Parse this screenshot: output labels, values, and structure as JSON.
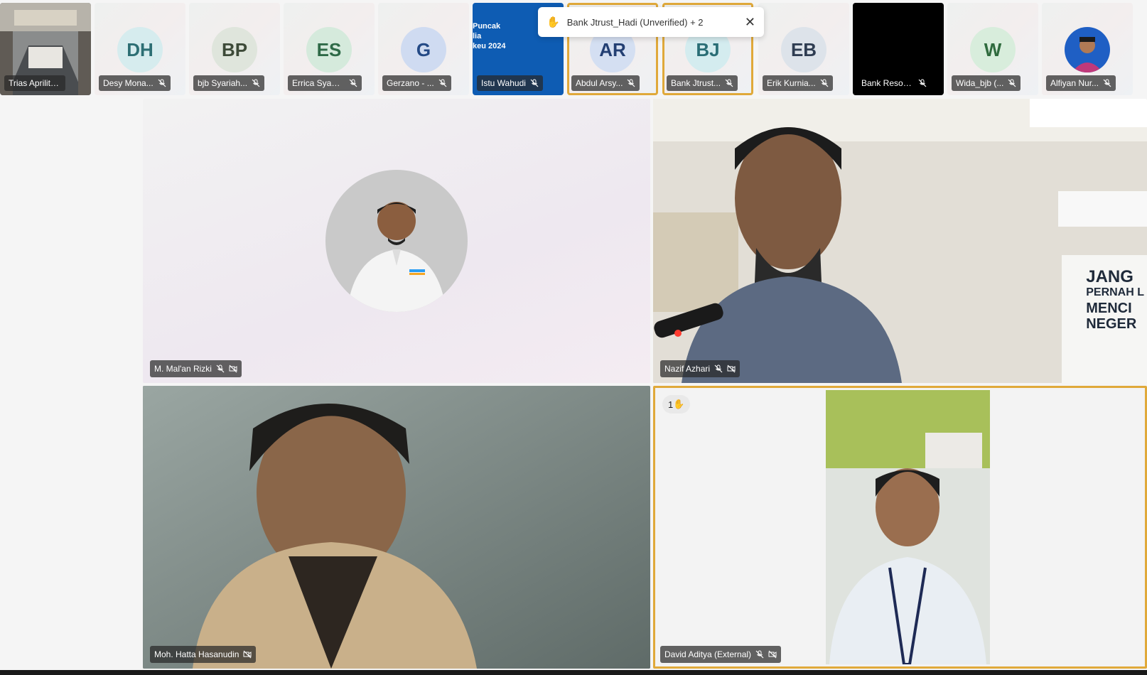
{
  "raise_hand_toast": {
    "text": "Bank Jtrust_Hadi (Unverified) + 2",
    "icon": "raised-hand-icon",
    "close_icon": "close-icon"
  },
  "thumbnails": [
    {
      "name": "Trias Aprilitania",
      "initials": "",
      "type": "video-room"
    },
    {
      "name": "Desy Mona...",
      "initials": "DH",
      "avatar_bg": "#d6ecee",
      "avatar_fg": "#2d6f74"
    },
    {
      "name": "bjb Syariah...",
      "initials": "BP",
      "avatar_bg": "#dfe5dc",
      "avatar_fg": "#3d4a38"
    },
    {
      "name": "Errica Syam...",
      "initials": "ES",
      "avatar_bg": "#d5eadc",
      "avatar_fg": "#2e6a47"
    },
    {
      "name": "Gerzano - ...",
      "initials": "G",
      "avatar_bg": "#cfdbf1",
      "avatar_fg": "#244a86"
    },
    {
      "name": "Istu Wahudi",
      "initials": "",
      "type": "slide",
      "slide_lines": [
        "Puncak",
        "lia",
        "keu 2024"
      ]
    },
    {
      "name": "Abdul Arsy...",
      "initials": "AR",
      "avatar_bg": "#d4dff2",
      "avatar_fg": "#233f73",
      "raised": true
    },
    {
      "name": "Bank Jtrust...",
      "initials": "BJ",
      "avatar_bg": "#d4ecef",
      "avatar_fg": "#2b6e76",
      "raised": true
    },
    {
      "name": "Erik Kurnia...",
      "initials": "EB",
      "avatar_bg": "#dde3ea",
      "avatar_fg": "#2f3d52"
    },
    {
      "name": "Bank Reson...",
      "initials": "",
      "type": "black"
    },
    {
      "name": "Wida_bjb (...",
      "initials": "W",
      "avatar_bg": "#d8eddc",
      "avatar_fg": "#2f6b3e"
    },
    {
      "name": "Alfiyan Nur...",
      "initials": "",
      "type": "photo"
    }
  ],
  "tiles": {
    "top_left": {
      "name": "M. Mal'an Rizki"
    },
    "top_right": {
      "name": "Nazif Azhari",
      "banner_lines": [
        "JANG",
        "PERNAH L",
        "MENCI",
        "NEGER"
      ]
    },
    "bottom_left": {
      "name": "Moh. Hatta Hasanudin"
    },
    "bottom_right": {
      "name": "David Aditya (External)",
      "hand_count": "1"
    }
  },
  "colors": {
    "raised_border": "#e0a93a",
    "pill_bg": "#333333"
  }
}
